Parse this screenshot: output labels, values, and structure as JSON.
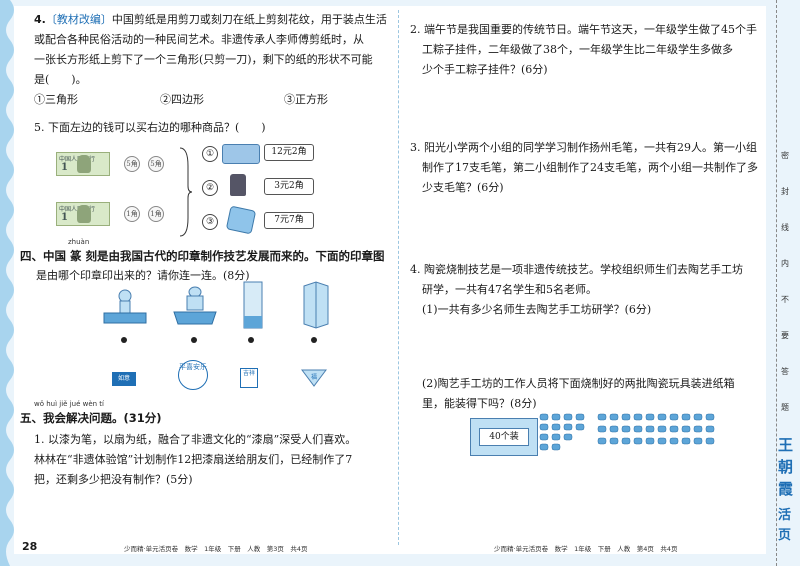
{
  "left": {
    "q4": {
      "num": "4.",
      "tag": "〔教材改编〕",
      "line1": "中国剪纸是用剪刀或刻刀在纸上剪刻花纹，用于装点生活",
      "line2": "或配合各种民俗活动的一种民间艺术。非遗传承人李师傅剪纸时，从",
      "line3": "一张长方形纸上剪下了一个三角形(只剪一刀)，剩下的纸的形状不可能",
      "line4": "是(　　)。",
      "opt1": "①三角形",
      "opt2": "②四边形",
      "opt3": "③正方形"
    },
    "q5": {
      "stem": "5. 下面左边的钱可以买右边的哪种商品？(　　)",
      "bill_label": "中国人民银行",
      "bill_value": "1",
      "coin1": "5角",
      "coin2": "5角",
      "coin3": "1角",
      "item1_num": "①",
      "item2_num": "②",
      "item3_num": "③",
      "price1": "12元2角",
      "price2": "3元2角",
      "price3": "7元7角"
    },
    "sec4": {
      "pinyin": "zhuàn",
      "line1": "四、中国 篆 刻是由我国古代的印章制作技艺发展而来的。下面的印章图",
      "line2": "是由哪个印章印出来的？请你连一连。(8分)",
      "stamp1": "如意",
      "stamp2": "平喜安乐",
      "stamp3": "吉祥",
      "stamp4": "福"
    },
    "sec5": {
      "pinyin": "wǒ huì jiě jué wèn tí",
      "title": "五、我会解决问题。(31分)",
      "q1_line1": "1. 以漆为笔，以扇为纸，融合了非遗文化的“漆扇”深受人们喜欢。",
      "q1_line2": "林林在“非遗体验馆”计划制作12把漆扇送给朋友们，已经制作了7",
      "q1_line3": "把，还剩多少把没有制作？(5分)"
    },
    "page_number": "28",
    "footer": "少而精·单元活页卷　数学　1年级　下册　人教　第3页　共4页"
  },
  "right": {
    "q2": {
      "line1": "2. 端午节是我国重要的传统节日。端午节这天，一年级学生做了45个手",
      "line2": "工粽子挂件，二年级做了38个，一年级学生比二年级学生多做多",
      "line3": "少个手工粽子挂件？(6分)"
    },
    "q3": {
      "line1": "3. 阳光小学两个小组的同学学习制作扬州毛笔，一共有29人。第一小组",
      "line2": "制作了17支毛笔，第二小组制作了24支毛笔，两个小组一共制作了多",
      "line3": "少支毛笔？(6分)"
    },
    "q4": {
      "line1": "4. 陶瓷烧制技艺是一项非遗传统技艺。学校组织师生们去陶艺手工坊",
      "line2": "研学，一共有47名学生和5名老师。",
      "sub1": "(1)一共有多少名师生去陶艺手工坊研学？(6分)",
      "sub2_line1": "(2)陶艺手工坊的工作人员将下面烧制好的两批陶瓷玩具装进纸箱",
      "sub2_line2": "里，能装得下吗？(8分)",
      "box_label": "40个装"
    },
    "footer": "少而精·单元活页卷　数学　1年级　下册　人教　第4页　共4页"
  },
  "side": {
    "chars": [
      "密",
      "封",
      "线",
      "内",
      "不",
      "要",
      "答",
      "题"
    ],
    "brand": [
      "王",
      "朝",
      "霞",
      "活",
      "页"
    ]
  }
}
